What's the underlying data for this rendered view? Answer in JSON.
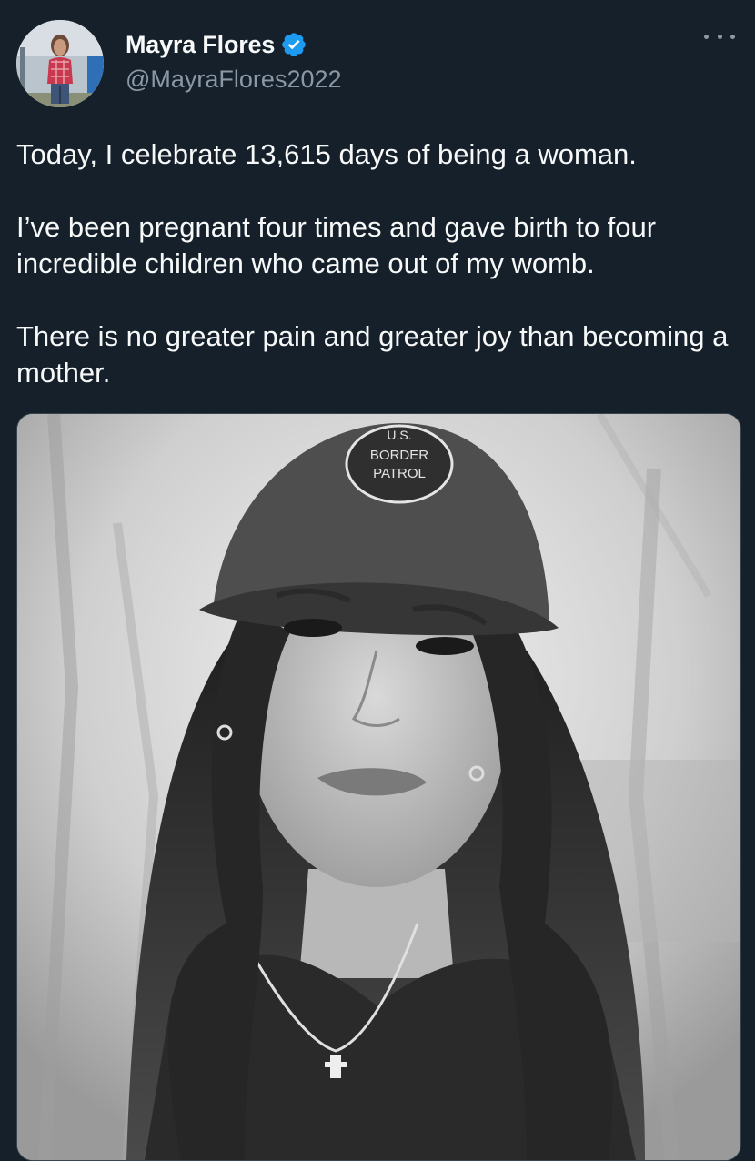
{
  "author": {
    "display_name": "Mayra Flores",
    "handle": "@MayraFlores2022",
    "verified_icon": "verified-badge-icon",
    "avatar_icon": "avatar-photo"
  },
  "more_menu": {
    "icon": "more-horizontal-icon"
  },
  "tweet": {
    "paragraphs": [
      "Today, I celebrate 13,615 days of being a woman.",
      "I’ve been pregnant four times and gave birth to four incredible children who came out of my womb.",
      "There is no greater pain and greater joy than becoming a mother."
    ]
  },
  "media": {
    "type": "photo",
    "cap_patch_text": [
      "U.S.",
      "BORDER",
      "PATROL"
    ]
  },
  "colors": {
    "background": "#15202b",
    "primary_text": "#f7f9f9",
    "secondary_text": "#8b98a5",
    "verified_blue": "#1d9bf0",
    "border": "#38444d"
  }
}
